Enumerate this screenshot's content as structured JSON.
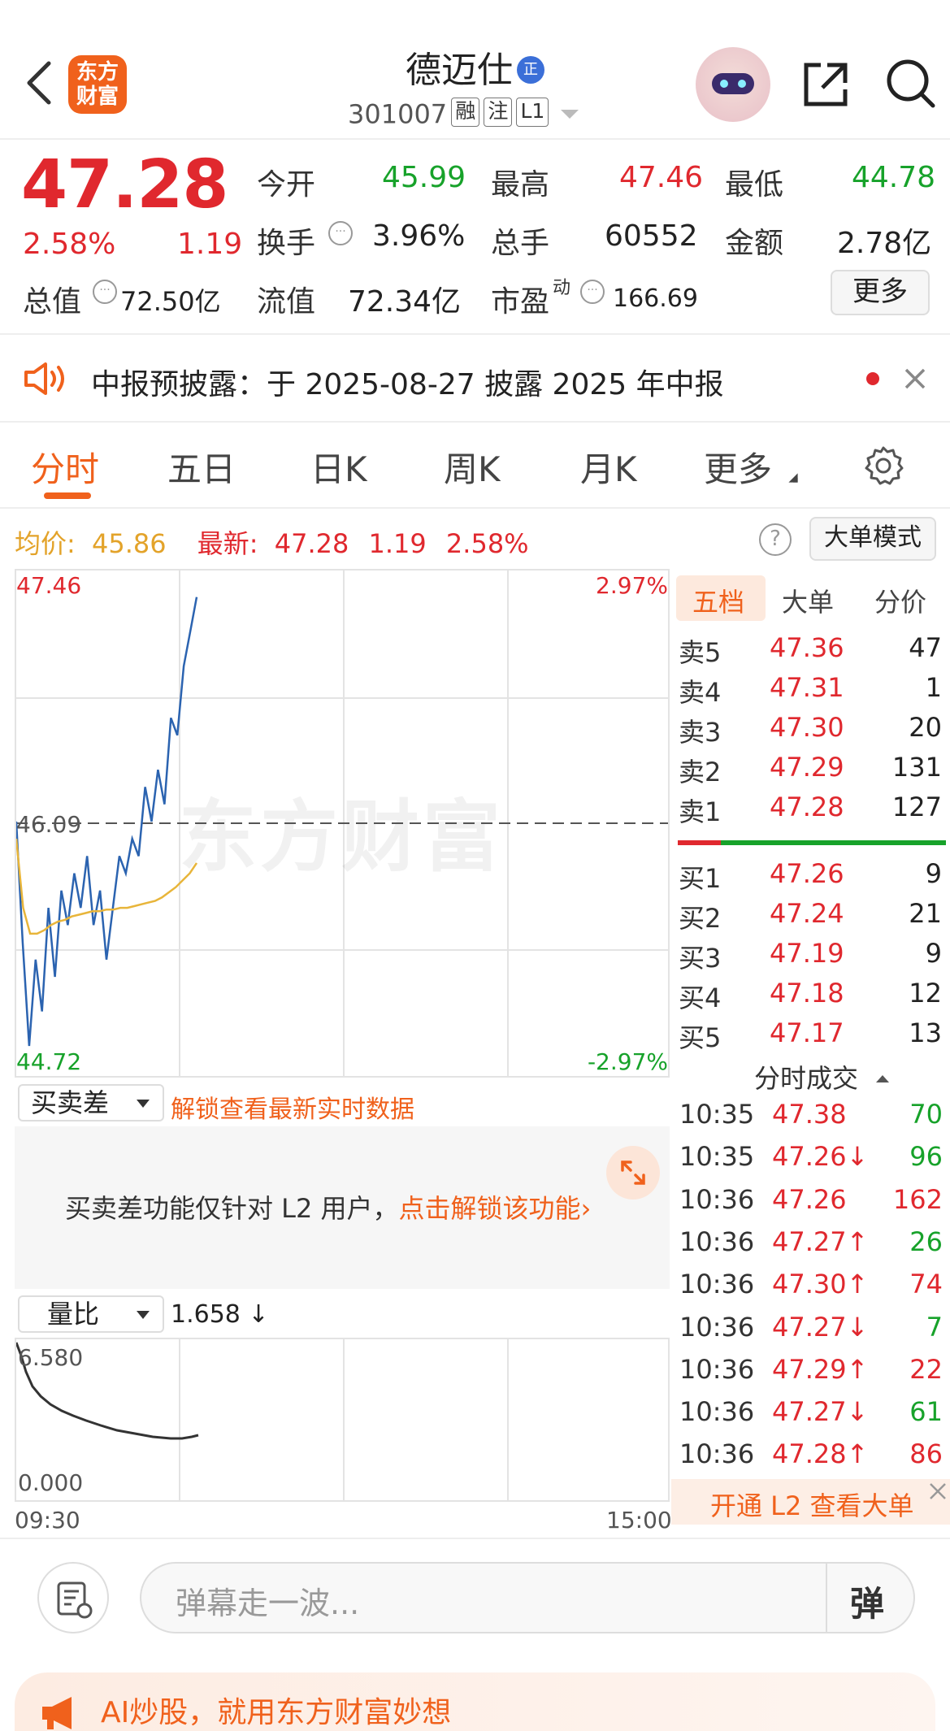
{
  "header": {
    "logo_text": "东方财富",
    "stock_name": "德迈仕",
    "stock_tag": "正",
    "code": "301007",
    "badges": [
      "融",
      "注",
      "L1"
    ]
  },
  "quote": {
    "price": "47.28",
    "change_pct": "2.58%",
    "change": "1.19",
    "open_label": "今开",
    "open": "45.99",
    "high_label": "最高",
    "high": "47.46",
    "low_label": "最低",
    "low": "44.78",
    "turnover_label": "换手",
    "turnover": "3.96%",
    "volume_label": "总手",
    "volume": "60552",
    "amount_label": "金额",
    "amount": "2.78亿",
    "mktcap_label": "总值",
    "mktcap": "72.50亿",
    "float_label": "流值",
    "float_cap": "72.34亿",
    "pe_label": "市盈",
    "pe_sup": "动",
    "pe": "166.69",
    "more_label": "更多"
  },
  "notice": {
    "text": "中报预披露：于 2025-08-27 披露 2025 年中报"
  },
  "tabs": [
    "分时",
    "五日",
    "日K",
    "周K",
    "月K",
    "更多"
  ],
  "info_bar": {
    "avg_label": "均价:",
    "avg": "45.86",
    "latest_label": "最新:",
    "latest": "47.28",
    "chg": "1.19",
    "chg_pct": "2.58%",
    "mode_label": "大单模式"
  },
  "chart_labels": {
    "y_top": "47.46",
    "y_mid": "46.09",
    "y_bot": "44.72",
    "pct_top": "2.97%",
    "pct_bot": "-2.97%",
    "watermark": "东方财富"
  },
  "chart_data": {
    "type": "line",
    "ylim": [
      44.72,
      47.46
    ],
    "reference": 46.09,
    "series": [
      {
        "values": [
          46.1,
          45.4,
          44.8,
          45.3,
          45.0,
          45.6,
          45.2,
          45.7,
          45.5,
          45.8,
          45.6,
          45.9,
          45.5,
          45.7,
          45.3,
          45.6,
          45.9,
          45.8,
          46.0,
          45.9,
          46.3,
          46.1,
          46.4,
          46.2,
          46.7,
          46.6,
          47.0,
          47.2,
          47.4
        ]
      },
      {
        "values": [
          46.0,
          45.6,
          45.45,
          45.45,
          45.47,
          45.5,
          45.52,
          45.53,
          45.55,
          45.56,
          45.57,
          45.58,
          45.58,
          45.59,
          45.59,
          45.6,
          45.6,
          45.61,
          45.62,
          45.63,
          45.64,
          45.66,
          45.69,
          45.72,
          45.76,
          45.8,
          45.86
        ]
      }
    ]
  },
  "order_book": {
    "tabs": [
      "五档",
      "大单",
      "分价"
    ],
    "asks": [
      {
        "label": "卖5",
        "price": "47.36",
        "vol": "47"
      },
      {
        "label": "卖4",
        "price": "47.31",
        "vol": "1"
      },
      {
        "label": "卖3",
        "price": "47.30",
        "vol": "20"
      },
      {
        "label": "卖2",
        "price": "47.29",
        "vol": "131"
      },
      {
        "label": "卖1",
        "price": "47.28",
        "vol": "127"
      }
    ],
    "bids": [
      {
        "label": "买1",
        "price": "47.26",
        "vol": "9"
      },
      {
        "label": "买2",
        "price": "47.24",
        "vol": "21"
      },
      {
        "label": "买3",
        "price": "47.19",
        "vol": "9"
      },
      {
        "label": "买4",
        "price": "47.18",
        "vol": "12"
      },
      {
        "label": "买5",
        "price": "47.17",
        "vol": "13"
      }
    ],
    "trades_title": "分时成交",
    "trades": [
      {
        "t": "10:35",
        "p": "47.38",
        "v": "70",
        "c": "green"
      },
      {
        "t": "10:35",
        "p": "47.26↓",
        "v": "96",
        "c": "green"
      },
      {
        "t": "10:36",
        "p": "47.26",
        "v": "162",
        "c": "red"
      },
      {
        "t": "10:36",
        "p": "47.27↑",
        "v": "26",
        "c": "green"
      },
      {
        "t": "10:36",
        "p": "47.30↑",
        "v": "74",
        "c": "red"
      },
      {
        "t": "10:36",
        "p": "47.27↓",
        "v": "7",
        "c": "green"
      },
      {
        "t": "10:36",
        "p": "47.29↑",
        "v": "22",
        "c": "red"
      },
      {
        "t": "10:36",
        "p": "47.27↓",
        "v": "61",
        "c": "green"
      },
      {
        "t": "10:36",
        "p": "47.28↑",
        "v": "86",
        "c": "red"
      }
    ],
    "l2_label": "开通 L2 查看大单"
  },
  "spread": {
    "select": "买卖差",
    "unlock": "解锁查看最新实时数据",
    "msg": "买卖差功能仅针对 L2 用户，",
    "msg_link": "点击解锁该功能",
    "msg_arrow": "›"
  },
  "volratio": {
    "select": "量比",
    "value": "1.658 ↓",
    "y_top": "6.580",
    "y_bot": "0.000",
    "x_start": "09:30",
    "x_end": "15:00"
  },
  "comment": {
    "placeholder": "弹幕走一波...",
    "danmu": "弹"
  },
  "ai_banner": {
    "text": "AI炒股，就用东方财富妙想"
  }
}
